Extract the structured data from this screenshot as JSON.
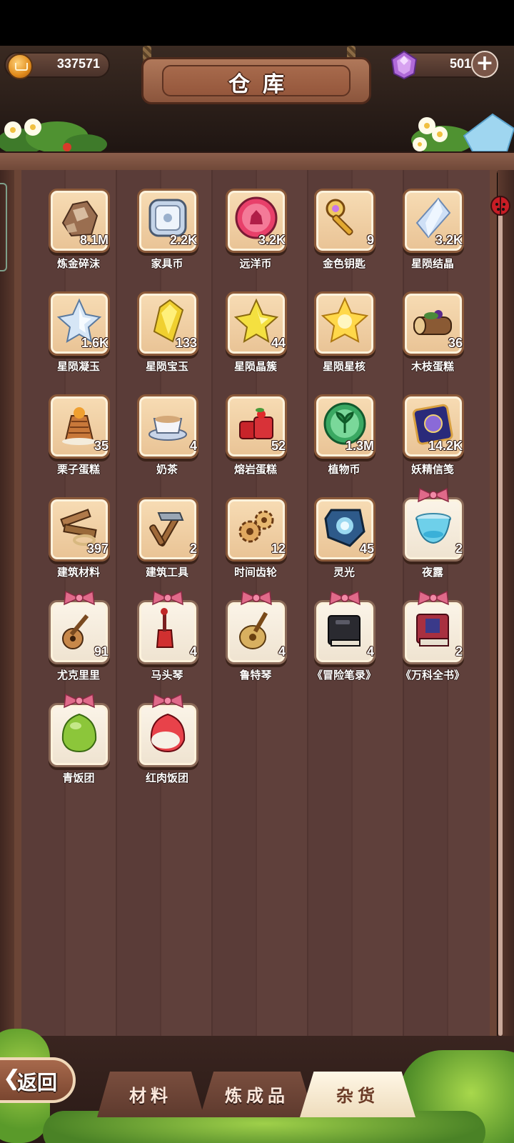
{
  "header": {
    "title": "仓库",
    "coins": "337571",
    "gems": "501"
  },
  "items": [
    {
      "label": "炼金碎沫",
      "count": "8.1M",
      "icon": "rock-shards-icon",
      "special": false
    },
    {
      "label": "家具币",
      "count": "2.2K",
      "icon": "furniture-coin-icon",
      "special": false
    },
    {
      "label": "远洋币",
      "count": "3.2K",
      "icon": "ocean-coin-icon",
      "special": false
    },
    {
      "label": "金色钥匙",
      "count": "9",
      "icon": "golden-key-icon",
      "special": false
    },
    {
      "label": "星陨结晶",
      "count": "3.2K",
      "icon": "star-crystal-icon",
      "special": false
    },
    {
      "label": "星陨凝玉",
      "count": "1.6K",
      "icon": "silver-star-icon",
      "special": false
    },
    {
      "label": "星陨宝玉",
      "count": "133",
      "icon": "yellow-gem-icon",
      "special": false
    },
    {
      "label": "星陨晶簇",
      "count": "44",
      "icon": "yellow-star-icon",
      "special": false
    },
    {
      "label": "星陨星核",
      "count": "",
      "icon": "glowing-star-icon",
      "special": false
    },
    {
      "label": "木枝蛋糕",
      "count": "36",
      "icon": "log-cake-icon",
      "special": false
    },
    {
      "label": "栗子蛋糕",
      "count": "35",
      "icon": "chestnut-cake-icon",
      "special": false
    },
    {
      "label": "奶茶",
      "count": "4",
      "icon": "milk-tea-icon",
      "special": false
    },
    {
      "label": "熔岩蛋糕",
      "count": "52",
      "icon": "lava-cake-icon",
      "special": false
    },
    {
      "label": "植物币",
      "count": "1.3M",
      "icon": "plant-coin-icon",
      "special": false
    },
    {
      "label": "妖精信笺",
      "count": "14.2K",
      "icon": "fairy-letter-icon",
      "special": false
    },
    {
      "label": "建筑材料",
      "count": "397",
      "icon": "building-materials-icon",
      "special": false
    },
    {
      "label": "建筑工具",
      "count": "2",
      "icon": "building-tools-icon",
      "special": false
    },
    {
      "label": "时间齿轮",
      "count": "12",
      "icon": "time-gears-icon",
      "special": false
    },
    {
      "label": "灵光",
      "count": "45",
      "icon": "inspiration-icon",
      "special": false
    },
    {
      "label": "夜露",
      "count": "2",
      "icon": "night-dew-icon",
      "special": true
    },
    {
      "label": "尤克里里",
      "count": "91",
      "icon": "ukulele-icon",
      "special": true
    },
    {
      "label": "马头琴",
      "count": "4",
      "icon": "morin-khuur-icon",
      "special": true
    },
    {
      "label": "鲁特琴",
      "count": "4",
      "icon": "lute-icon",
      "special": true
    },
    {
      "label": "《冒险笔录》",
      "count": "4",
      "icon": "black-book-icon",
      "special": true
    },
    {
      "label": "《万科全书》",
      "count": "2",
      "icon": "red-book-icon",
      "special": true
    },
    {
      "label": "青饭团",
      "count": "",
      "icon": "green-rice-ball-icon",
      "special": true
    },
    {
      "label": "红肉饭团",
      "count": "",
      "icon": "red-rice-ball-icon",
      "special": true
    }
  ],
  "tabs": [
    {
      "label": "材料",
      "active": false
    },
    {
      "label": "炼成品",
      "active": false
    },
    {
      "label": "杂货",
      "active": true
    }
  ],
  "back_label": "返回"
}
